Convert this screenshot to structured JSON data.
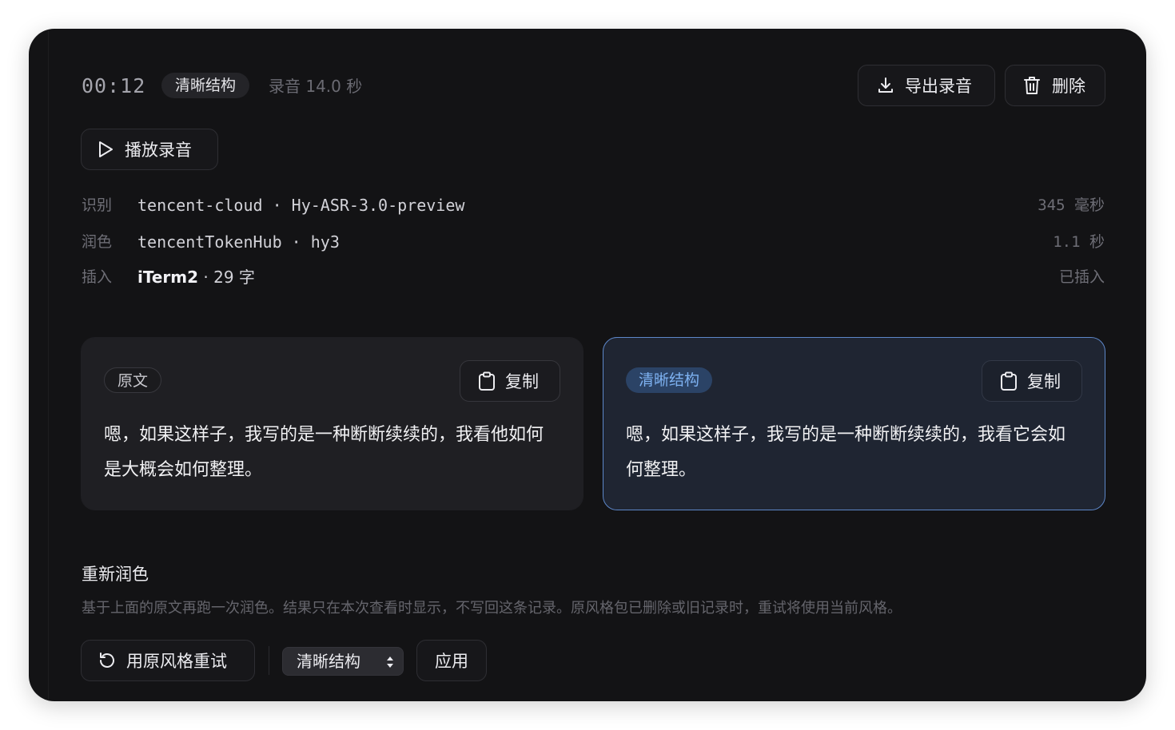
{
  "header": {
    "time": "00:12",
    "style_badge": "清晰结构",
    "duration": "录音 14.0 秒",
    "export_label": "导出录音",
    "delete_label": "删除"
  },
  "player": {
    "play_label": "播放录音"
  },
  "meta": {
    "recognition": {
      "label": "识别",
      "provider": "tencent-cloud",
      "separator": " · ",
      "model": "Hy-ASR-3.0-preview",
      "latency": "345 毫秒"
    },
    "polish": {
      "label": "润色",
      "provider": "tencentTokenHub",
      "separator": " · ",
      "model": "hy3",
      "latency": "1.1 秒"
    },
    "insert": {
      "label": "插入",
      "app": "iTerm2",
      "chars": " · 29 字",
      "status": "已插入"
    }
  },
  "cards": {
    "original": {
      "tag": "原文",
      "copy_label": "复制",
      "text": "嗯，如果这样子，我写的是一种断断续续的，我看他如何是大概会如何整理。"
    },
    "polished": {
      "tag": "清晰结构",
      "copy_label": "复制",
      "text": "嗯，如果这样子，我写的是一种断断续续的，我看它会如何整理。"
    }
  },
  "repolish": {
    "title": "重新润色",
    "description": "基于上面的原文再跑一次润色。结果只在本次查看时显示，不写回这条记录。原风格包已删除或旧记录时，重试将使用当前风格。",
    "retry_label": "用原风格重试",
    "selected_style": "清晰结构",
    "apply_label": "应用"
  },
  "colors": {
    "background": "#131315",
    "accent_border": "#5d87c9",
    "accent_tag_text": "#7eb2f2",
    "polished_card_bg": "#1f2532"
  },
  "icons": [
    "download-icon",
    "trash-icon",
    "play-icon",
    "clipboard-icon",
    "retry-icon",
    "select-arrows-icon"
  ]
}
